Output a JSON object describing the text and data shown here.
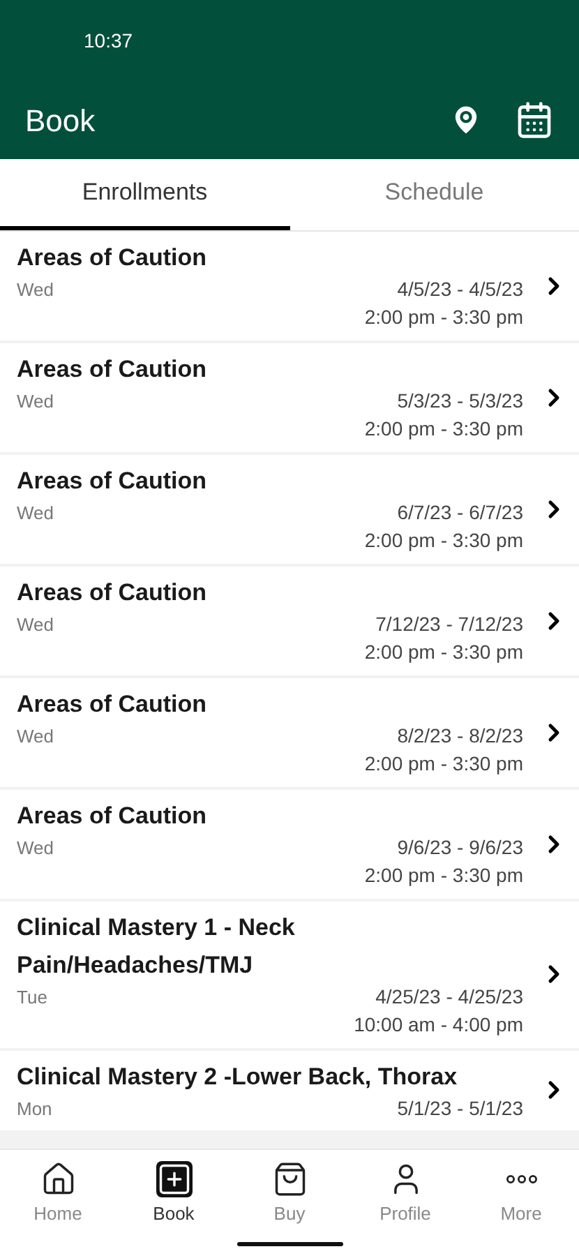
{
  "status_bar": {
    "time": "10:37"
  },
  "header": {
    "title": "Book"
  },
  "tabs": [
    {
      "label": "Enrollments",
      "selected": true
    },
    {
      "label": "Schedule",
      "selected": false
    }
  ],
  "enrollments": [
    {
      "title": "Areas of Caution",
      "day": "Wed",
      "dates": "4/5/23 - 4/5/23",
      "time": "2:00 pm - 3:30 pm"
    },
    {
      "title": "Areas of Caution",
      "day": "Wed",
      "dates": "5/3/23 - 5/3/23",
      "time": "2:00 pm - 3:30 pm"
    },
    {
      "title": "Areas of Caution",
      "day": "Wed",
      "dates": "6/7/23 - 6/7/23",
      "time": "2:00 pm - 3:30 pm"
    },
    {
      "title": "Areas of Caution",
      "day": "Wed",
      "dates": "7/12/23 - 7/12/23",
      "time": "2:00 pm - 3:30 pm"
    },
    {
      "title": "Areas of Caution",
      "day": "Wed",
      "dates": "8/2/23 - 8/2/23",
      "time": "2:00 pm - 3:30 pm"
    },
    {
      "title": "Areas of Caution",
      "day": "Wed",
      "dates": "9/6/23 - 9/6/23",
      "time": "2:00 pm - 3:30 pm"
    },
    {
      "title": "Clinical Mastery 1 - Neck Pain/Headaches/TMJ",
      "day": "Tue",
      "dates": "4/25/23 - 4/25/23",
      "time": "10:00 am - 4:00 pm"
    },
    {
      "title": "Clinical Mastery 2 -Lower Back, Thorax",
      "day": "Mon",
      "dates": "5/1/23 - 5/1/23"
    }
  ],
  "bottom_nav": [
    {
      "label": "Home",
      "selected": false
    },
    {
      "label": "Book",
      "selected": true
    },
    {
      "label": "Buy",
      "selected": false
    },
    {
      "label": "Profile",
      "selected": false
    },
    {
      "label": "More",
      "selected": false
    }
  ]
}
